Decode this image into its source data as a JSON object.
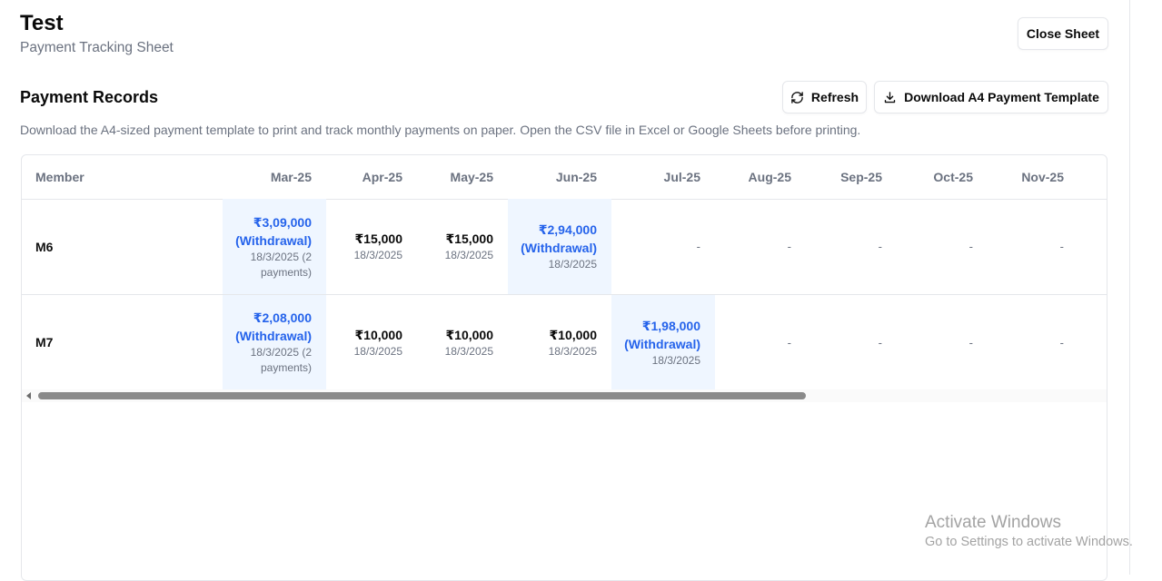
{
  "header": {
    "title": "Test",
    "subtitle": "Payment Tracking Sheet",
    "close_label": "Close Sheet"
  },
  "section": {
    "title": "Payment Records",
    "refresh_label": "Refresh",
    "download_label": "Download A4 Payment Template",
    "description": "Download the A4-sized payment template to print and track monthly payments on paper. Open the CSV file in Excel or Google Sheets before printing."
  },
  "table": {
    "member_header": "Member",
    "months": [
      "Mar-25",
      "Apr-25",
      "May-25",
      "Jun-25",
      "Jul-25",
      "Aug-25",
      "Sep-25",
      "Oct-25",
      "Nov-25"
    ],
    "rows": [
      {
        "member": "M6",
        "cells": [
          {
            "amount": "₹3,09,000",
            "withdrawal": "(Withdrawal)",
            "date": "18/3/2025 (2 payments)"
          },
          {
            "amount": "₹15,000",
            "date": "18/3/2025"
          },
          {
            "amount": "₹15,000",
            "date": "18/3/2025"
          },
          {
            "amount": "₹2,94,000",
            "withdrawal": "(Withdrawal)",
            "date": "18/3/2025"
          },
          {
            "empty": "-"
          },
          {
            "empty": "-"
          },
          {
            "empty": "-"
          },
          {
            "empty": "-"
          },
          {
            "empty": "-"
          }
        ]
      },
      {
        "member": "M7",
        "cells": [
          {
            "amount": "₹2,08,000",
            "withdrawal": "(Withdrawal)",
            "date": "18/3/2025 (2 payments)"
          },
          {
            "amount": "₹10,000",
            "date": "18/3/2025"
          },
          {
            "amount": "₹10,000",
            "date": "18/3/2025"
          },
          {
            "amount": "₹10,000",
            "date": "18/3/2025"
          },
          {
            "amount": "₹1,98,000",
            "withdrawal": "(Withdrawal)",
            "date": "18/3/2025"
          },
          {
            "empty": "-"
          },
          {
            "empty": "-"
          },
          {
            "empty": "-"
          },
          {
            "empty": "-"
          }
        ]
      }
    ]
  },
  "watermark": {
    "line1": "Activate Windows",
    "line2": "Go to Settings to activate Windows."
  },
  "colors": {
    "withdrawal_text": "#2563eb",
    "withdrawal_bg": "#eff6ff"
  }
}
